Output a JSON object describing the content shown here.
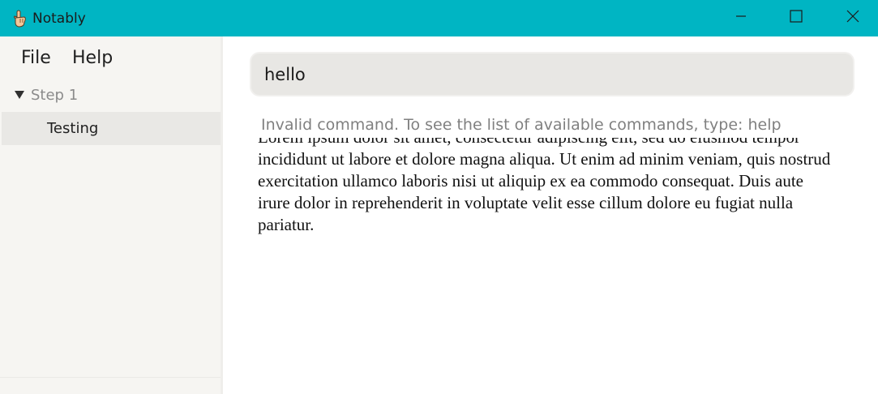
{
  "window": {
    "title": "Notably",
    "app_icon": "pointing-hand-icon",
    "controls": {
      "minimize_icon": "minimize-icon",
      "maximize_icon": "maximize-icon",
      "close_icon": "close-icon"
    },
    "titlebar_color": "#00b5c3"
  },
  "menu": {
    "file": "File",
    "help": "Help"
  },
  "sidebar": {
    "group": {
      "label": "Step 1",
      "expanded": true,
      "icon": "caret-down-icon"
    },
    "items": [
      {
        "label": "Testing",
        "selected": true
      }
    ]
  },
  "command": {
    "value": "hello",
    "feedback": "Invalid command. To see the list of available commands, type: help"
  },
  "note": {
    "body": "Lorem ipsum dolor sit amet, consectetur adipiscing elit, sed do eiusmod tempor incididunt ut labore et dolore magna aliqua. Ut enim ad minim veniam, quis nostrud exercitation ullamco laboris nisi ut aliquip ex ea commodo consequat. Duis aute irure dolor in reprehenderit in voluptate velit esse cillum dolore eu fugiat nulla pariatur."
  }
}
